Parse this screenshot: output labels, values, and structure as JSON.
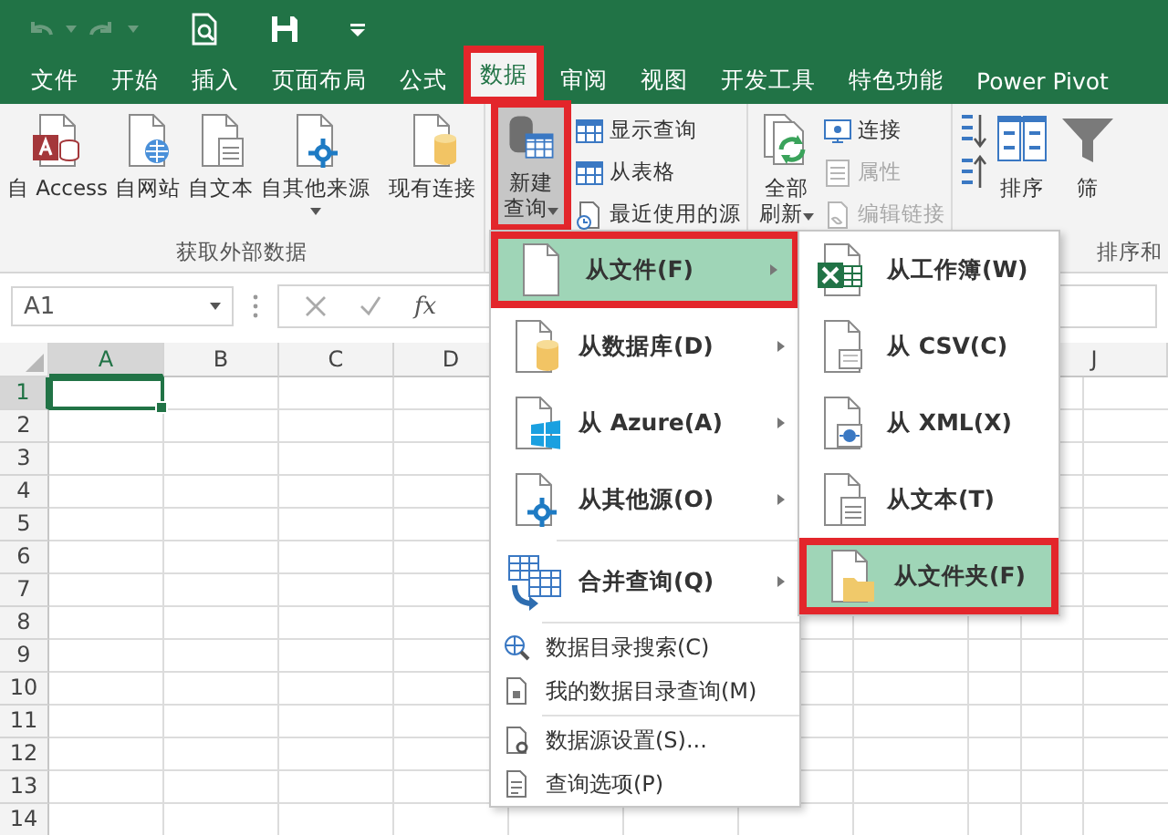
{
  "tabs": [
    {
      "label": "文件",
      "selected": false,
      "highlighted": false
    },
    {
      "label": "开始",
      "selected": false,
      "highlighted": false
    },
    {
      "label": "插入",
      "selected": false,
      "highlighted": false
    },
    {
      "label": "页面布局",
      "selected": false,
      "highlighted": false
    },
    {
      "label": "公式",
      "selected": false,
      "highlighted": false
    },
    {
      "label": "数据",
      "selected": true,
      "highlighted": true
    },
    {
      "label": "审阅",
      "selected": false,
      "highlighted": false
    },
    {
      "label": "视图",
      "selected": false,
      "highlighted": false
    },
    {
      "label": "开发工具",
      "selected": false,
      "highlighted": false
    },
    {
      "label": "特色功能",
      "selected": false,
      "highlighted": false
    },
    {
      "label": "Power Pivot",
      "selected": false,
      "highlighted": false
    }
  ],
  "ribbon": {
    "groups": [
      {
        "label": "获取外部数据",
        "buttons": [
          {
            "label": "自 Access",
            "dropdown": false
          },
          {
            "label": "自网站",
            "dropdown": false
          },
          {
            "label": "自文本",
            "dropdown": false
          },
          {
            "label": "自其他来源",
            "dropdown": true
          },
          {
            "label": "现有连接",
            "dropdown": false
          }
        ]
      },
      {
        "large": {
          "label": "新建查询",
          "dropdown": true,
          "pressed": true,
          "highlighted": true
        },
        "small": [
          {
            "label": "显示查询",
            "disabled": false
          },
          {
            "label": "从表格",
            "disabled": false
          },
          {
            "label": "最近使用的源",
            "disabled": false
          }
        ]
      },
      {
        "large": {
          "label": "全部刷新",
          "dropdown": true,
          "pressed": false,
          "highlighted": false
        },
        "small": [
          {
            "label": "连接",
            "disabled": false
          },
          {
            "label": "属性",
            "disabled": true
          },
          {
            "label": "编辑链接",
            "disabled": true
          }
        ]
      },
      {
        "label": "排序和",
        "buttons": [
          {
            "label": "排序",
            "dropdown": false
          },
          {
            "label": "筛",
            "dropdown": false
          }
        ]
      }
    ]
  },
  "formula_bar": {
    "name_box": "A1",
    "function_label": "fx"
  },
  "sheet": {
    "columns": [
      {
        "label": "A",
        "selected": true
      },
      {
        "label": "B",
        "selected": false
      },
      {
        "label": "C",
        "selected": false
      },
      {
        "label": "D",
        "selected": false
      },
      {
        "label": "J",
        "selected": false
      }
    ],
    "rows": [
      {
        "label": "1",
        "selected": true
      },
      {
        "label": "2",
        "selected": false
      },
      {
        "label": "3",
        "selected": false
      },
      {
        "label": "4",
        "selected": false
      },
      {
        "label": "5",
        "selected": false
      },
      {
        "label": "6",
        "selected": false
      },
      {
        "label": "7",
        "selected": false
      },
      {
        "label": "8",
        "selected": false
      },
      {
        "label": "9",
        "selected": false
      },
      {
        "label": "10",
        "selected": false
      },
      {
        "label": "11",
        "selected": false
      },
      {
        "label": "12",
        "selected": false
      },
      {
        "label": "13",
        "selected": false
      },
      {
        "label": "14",
        "selected": false
      }
    ]
  },
  "new_query_menu": {
    "sections": [
      [
        {
          "label": "从文件(F)",
          "has_submenu": true,
          "selected": true,
          "highlighted": true
        },
        {
          "label": "从数据库(D)",
          "has_submenu": true,
          "selected": false,
          "highlighted": false
        },
        {
          "label": "从 Azure(A)",
          "has_submenu": true,
          "selected": false,
          "highlighted": false
        },
        {
          "label": "从其他源(O)",
          "has_submenu": true,
          "selected": false,
          "highlighted": false
        }
      ],
      [
        {
          "label": "合并查询(Q)",
          "has_submenu": true,
          "selected": false,
          "highlighted": false
        }
      ],
      [
        {
          "label": "数据目录搜索(C)",
          "has_submenu": false,
          "selected": false,
          "highlighted": false
        },
        {
          "label": "我的数据目录查询(M)",
          "has_submenu": false,
          "selected": false,
          "highlighted": false
        }
      ],
      [
        {
          "label": "数据源设置(S)...",
          "has_submenu": false,
          "selected": false,
          "highlighted": false
        },
        {
          "label": "查询选项(P)",
          "has_submenu": false,
          "selected": false,
          "highlighted": false
        }
      ]
    ]
  },
  "from_file_submenu": {
    "items": [
      {
        "label": "从工作簿(W)",
        "selected": false,
        "highlighted": false
      },
      {
        "label": "从 CSV(C)",
        "selected": false,
        "highlighted": false
      },
      {
        "label": "从 XML(X)",
        "selected": false,
        "highlighted": false
      },
      {
        "label": "从文本(T)",
        "selected": false,
        "highlighted": false
      },
      {
        "label": "从文件夹(F)",
        "selected": true,
        "highlighted": true
      }
    ]
  }
}
